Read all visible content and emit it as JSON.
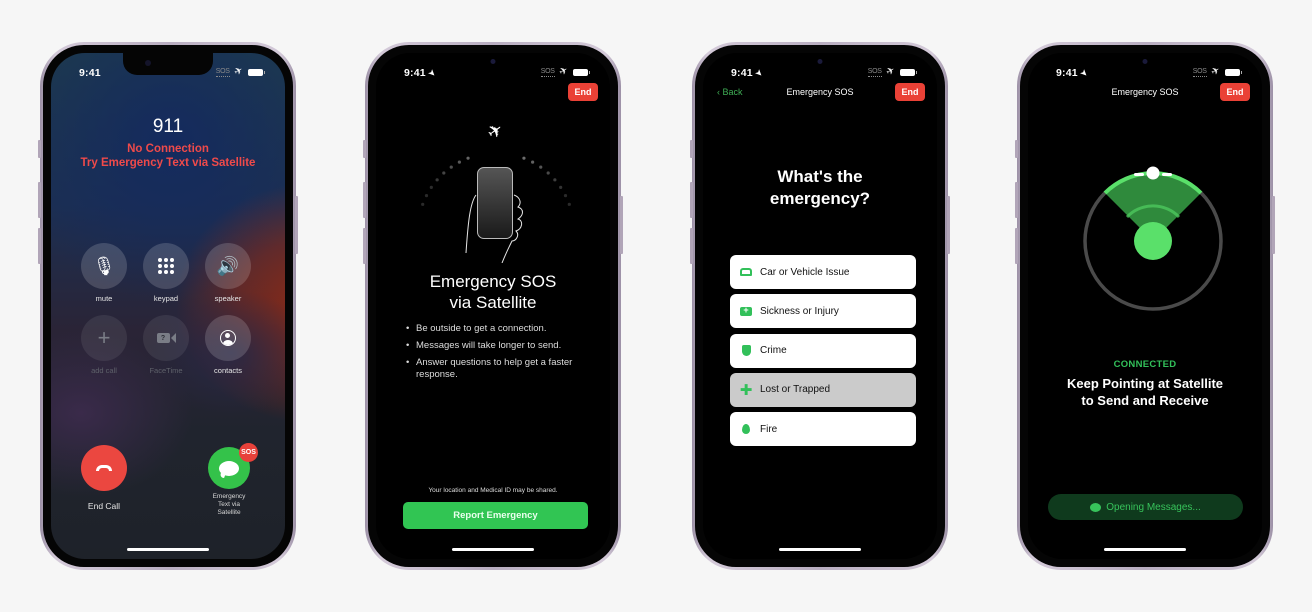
{
  "status_bar": {
    "time": "9:41",
    "sos_indicator": "SOS",
    "satellite_icon": "satellite-icon",
    "battery_icon": "battery-icon",
    "location_icon": "location-arrow-icon"
  },
  "phone1": {
    "number": "911",
    "status_line1": "No Connection",
    "status_line2": "Try Emergency Text via Satellite",
    "buttons": [
      {
        "label": "mute",
        "icon": "mic-slash-icon",
        "enabled": true
      },
      {
        "label": "keypad",
        "icon": "keypad-icon",
        "enabled": true
      },
      {
        "label": "speaker",
        "icon": "speaker-icon",
        "enabled": true
      },
      {
        "label": "add call",
        "icon": "plus-icon",
        "enabled": false
      },
      {
        "label": "FaceTime",
        "icon": "facetime-icon",
        "enabled": false
      },
      {
        "label": "contacts",
        "icon": "contacts-icon",
        "enabled": true
      }
    ],
    "end_call_label": "End Call",
    "emergency_text_label_1": "Emergency",
    "emergency_text_label_2": "Text via",
    "emergency_text_label_3": "Satellite",
    "sos_badge": "SOS",
    "colors": {
      "alert": "#ef4a4a",
      "end_call": "#eb4740",
      "messages_green": "#34c24a"
    }
  },
  "phone2": {
    "end_label": "End",
    "title_line1": "Emergency SOS",
    "title_line2": "via Satellite",
    "bullets": [
      "Be outside to get a connection.",
      "Messages will take longer to send.",
      "Answer questions to help get a faster response."
    ],
    "footer_note": "Your location and Medical ID may be shared.",
    "report_button": "Report Emergency",
    "colors": {
      "report": "#31c553",
      "end": "#ea4136"
    }
  },
  "phone3": {
    "back_label": "Back",
    "nav_title": "Emergency SOS",
    "end_label": "End",
    "question_line1": "What's the",
    "question_line2": "emergency?",
    "options": [
      {
        "label": "Car or Vehicle Issue",
        "icon": "car-icon",
        "selected": false
      },
      {
        "label": "Sickness or Injury",
        "icon": "medical-kit-icon",
        "selected": false
      },
      {
        "label": "Crime",
        "icon": "shield-icon",
        "selected": false
      },
      {
        "label": "Lost or Trapped",
        "icon": "cross-icon",
        "selected": true
      },
      {
        "label": "Fire",
        "icon": "flame-icon",
        "selected": false
      }
    ]
  },
  "phone4": {
    "nav_title": "Emergency SOS",
    "end_label": "End",
    "connection_status": "CONNECTED",
    "instruction_line1": "Keep Pointing at Satellite",
    "instruction_line2": "to Send and Receive",
    "opening_label": "Opening Messages...",
    "colors": {
      "green": "#32c05a",
      "radar_light": "#5ae06a"
    }
  }
}
